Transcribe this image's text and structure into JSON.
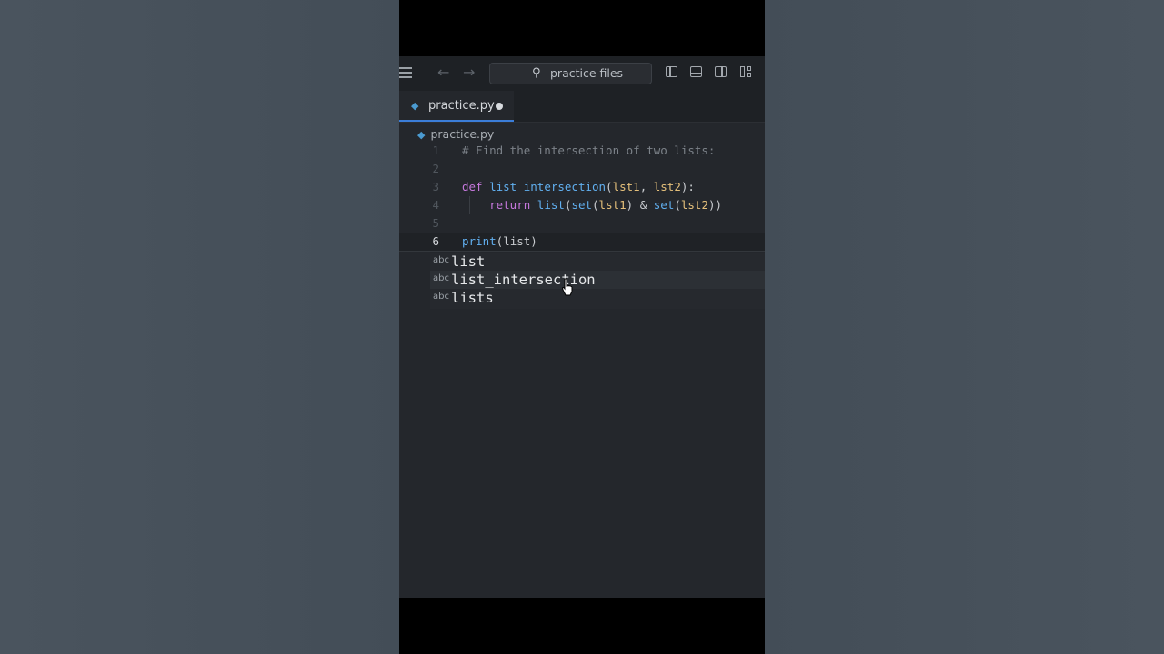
{
  "search": {
    "label": "practice files"
  },
  "tab": {
    "label": "practice.py"
  },
  "breadcrumb": {
    "file": "practice.py"
  },
  "code_lines": [
    {
      "num": "1",
      "text": "# Find the intersection of two lists:"
    },
    {
      "num": "2",
      "text": ""
    },
    {
      "num": "3",
      "text": "def list_intersection(lst1, lst2):"
    },
    {
      "num": "4",
      "text": "    return list(set(lst1) & set(lst2))"
    },
    {
      "num": "5",
      "text": ""
    },
    {
      "num": "6",
      "text": "print(list)"
    }
  ],
  "suggestions": [
    {
      "kind": "abc",
      "label": "list"
    },
    {
      "kind": "abc",
      "label": "list_intersection"
    },
    {
      "kind": "abc",
      "label": "lists"
    }
  ],
  "colors": {
    "keyword": "#c678dd",
    "function": "#61afef",
    "parameter": "#e5c07b",
    "comment": "#7c8289",
    "accent": "#3b7dd8"
  }
}
